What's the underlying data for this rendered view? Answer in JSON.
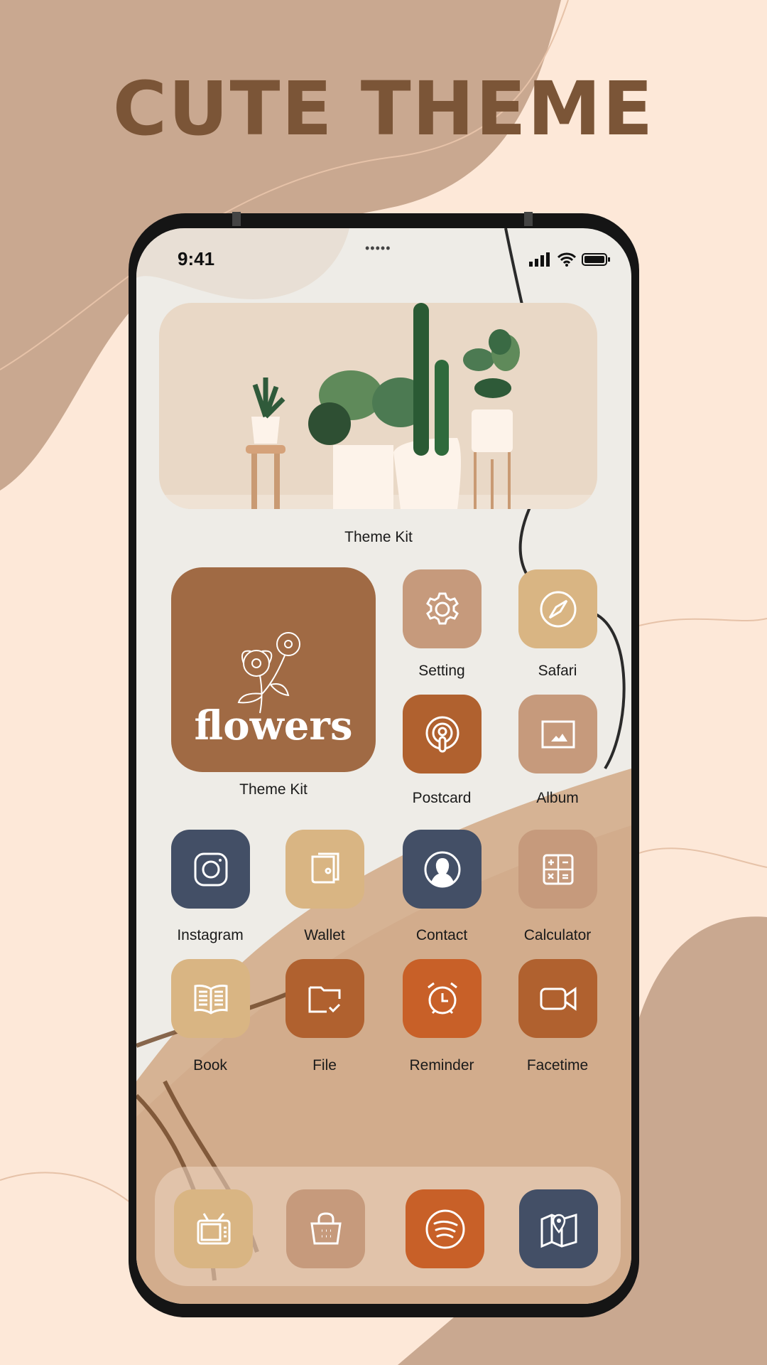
{
  "headline": "CUTE THEME",
  "status": {
    "time": "9:41",
    "notch": "•••••"
  },
  "widget": {
    "label": "Theme Kit"
  },
  "big_widget": {
    "word": "flowers",
    "label": "Theme Kit",
    "color": "#a06a44"
  },
  "apps": [
    {
      "label": "Setting",
      "icon": "gear",
      "color": "#c69a7c"
    },
    {
      "label": "Safari",
      "icon": "compass",
      "color": "#d9b583"
    },
    {
      "label": "Postcard",
      "icon": "podcast",
      "color": "#b0612f"
    },
    {
      "label": "Album",
      "icon": "image",
      "color": "#c69a7c"
    },
    {
      "label": "Instagram",
      "icon": "camera",
      "color": "#434f66"
    },
    {
      "label": "Wallet",
      "icon": "wallet",
      "color": "#d9b583"
    },
    {
      "label": "Contact",
      "icon": "person",
      "color": "#434f66"
    },
    {
      "label": "Calculator",
      "icon": "calculator",
      "color": "#c69a7c"
    },
    {
      "label": "Book",
      "icon": "book",
      "color": "#d9b583"
    },
    {
      "label": "File",
      "icon": "folder",
      "color": "#b0612f"
    },
    {
      "label": "Reminder",
      "icon": "alarm-clock",
      "color": "#c86028"
    },
    {
      "label": "Facetime",
      "icon": "video-camera",
      "color": "#b0612f"
    }
  ],
  "dock": [
    {
      "icon": "tv",
      "color": "#d9b583"
    },
    {
      "icon": "shopping-basket",
      "color": "#c69a7c"
    },
    {
      "icon": "spotify",
      "color": "#c86028"
    },
    {
      "icon": "map",
      "color": "#434f66"
    }
  ]
}
